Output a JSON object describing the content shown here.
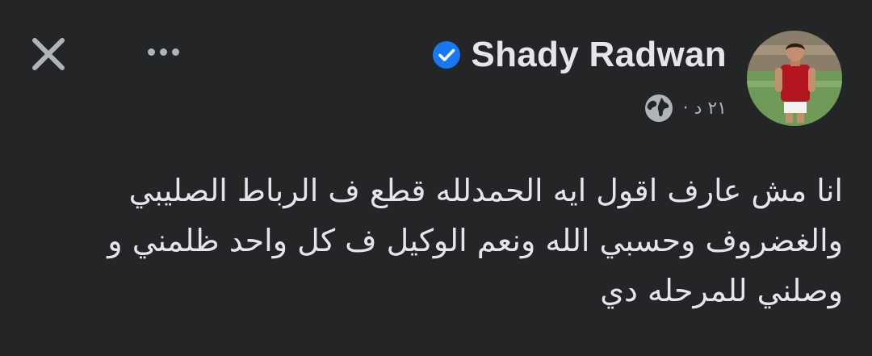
{
  "header": {
    "author_name": "Shady Radwan",
    "verified_icon": "verified-badge-icon",
    "close_icon": "close-icon",
    "more_icon": "more-options-icon"
  },
  "meta": {
    "timestamp": "٢١ د ·",
    "audience_icon": "globe-icon"
  },
  "post": {
    "text": "انا مش عارف اقول ايه الحمدلله قطع ف الرباط الصليبي\nوالغضروف وحسبي الله ونعم الوكيل ف كل واحد ظلمني و\nوصلني للمرحله دي"
  },
  "colors": {
    "background": "#242526",
    "primary_text": "#e4e6eb",
    "secondary_text": "#b0b3b8",
    "verified_blue": "#1877f2"
  }
}
